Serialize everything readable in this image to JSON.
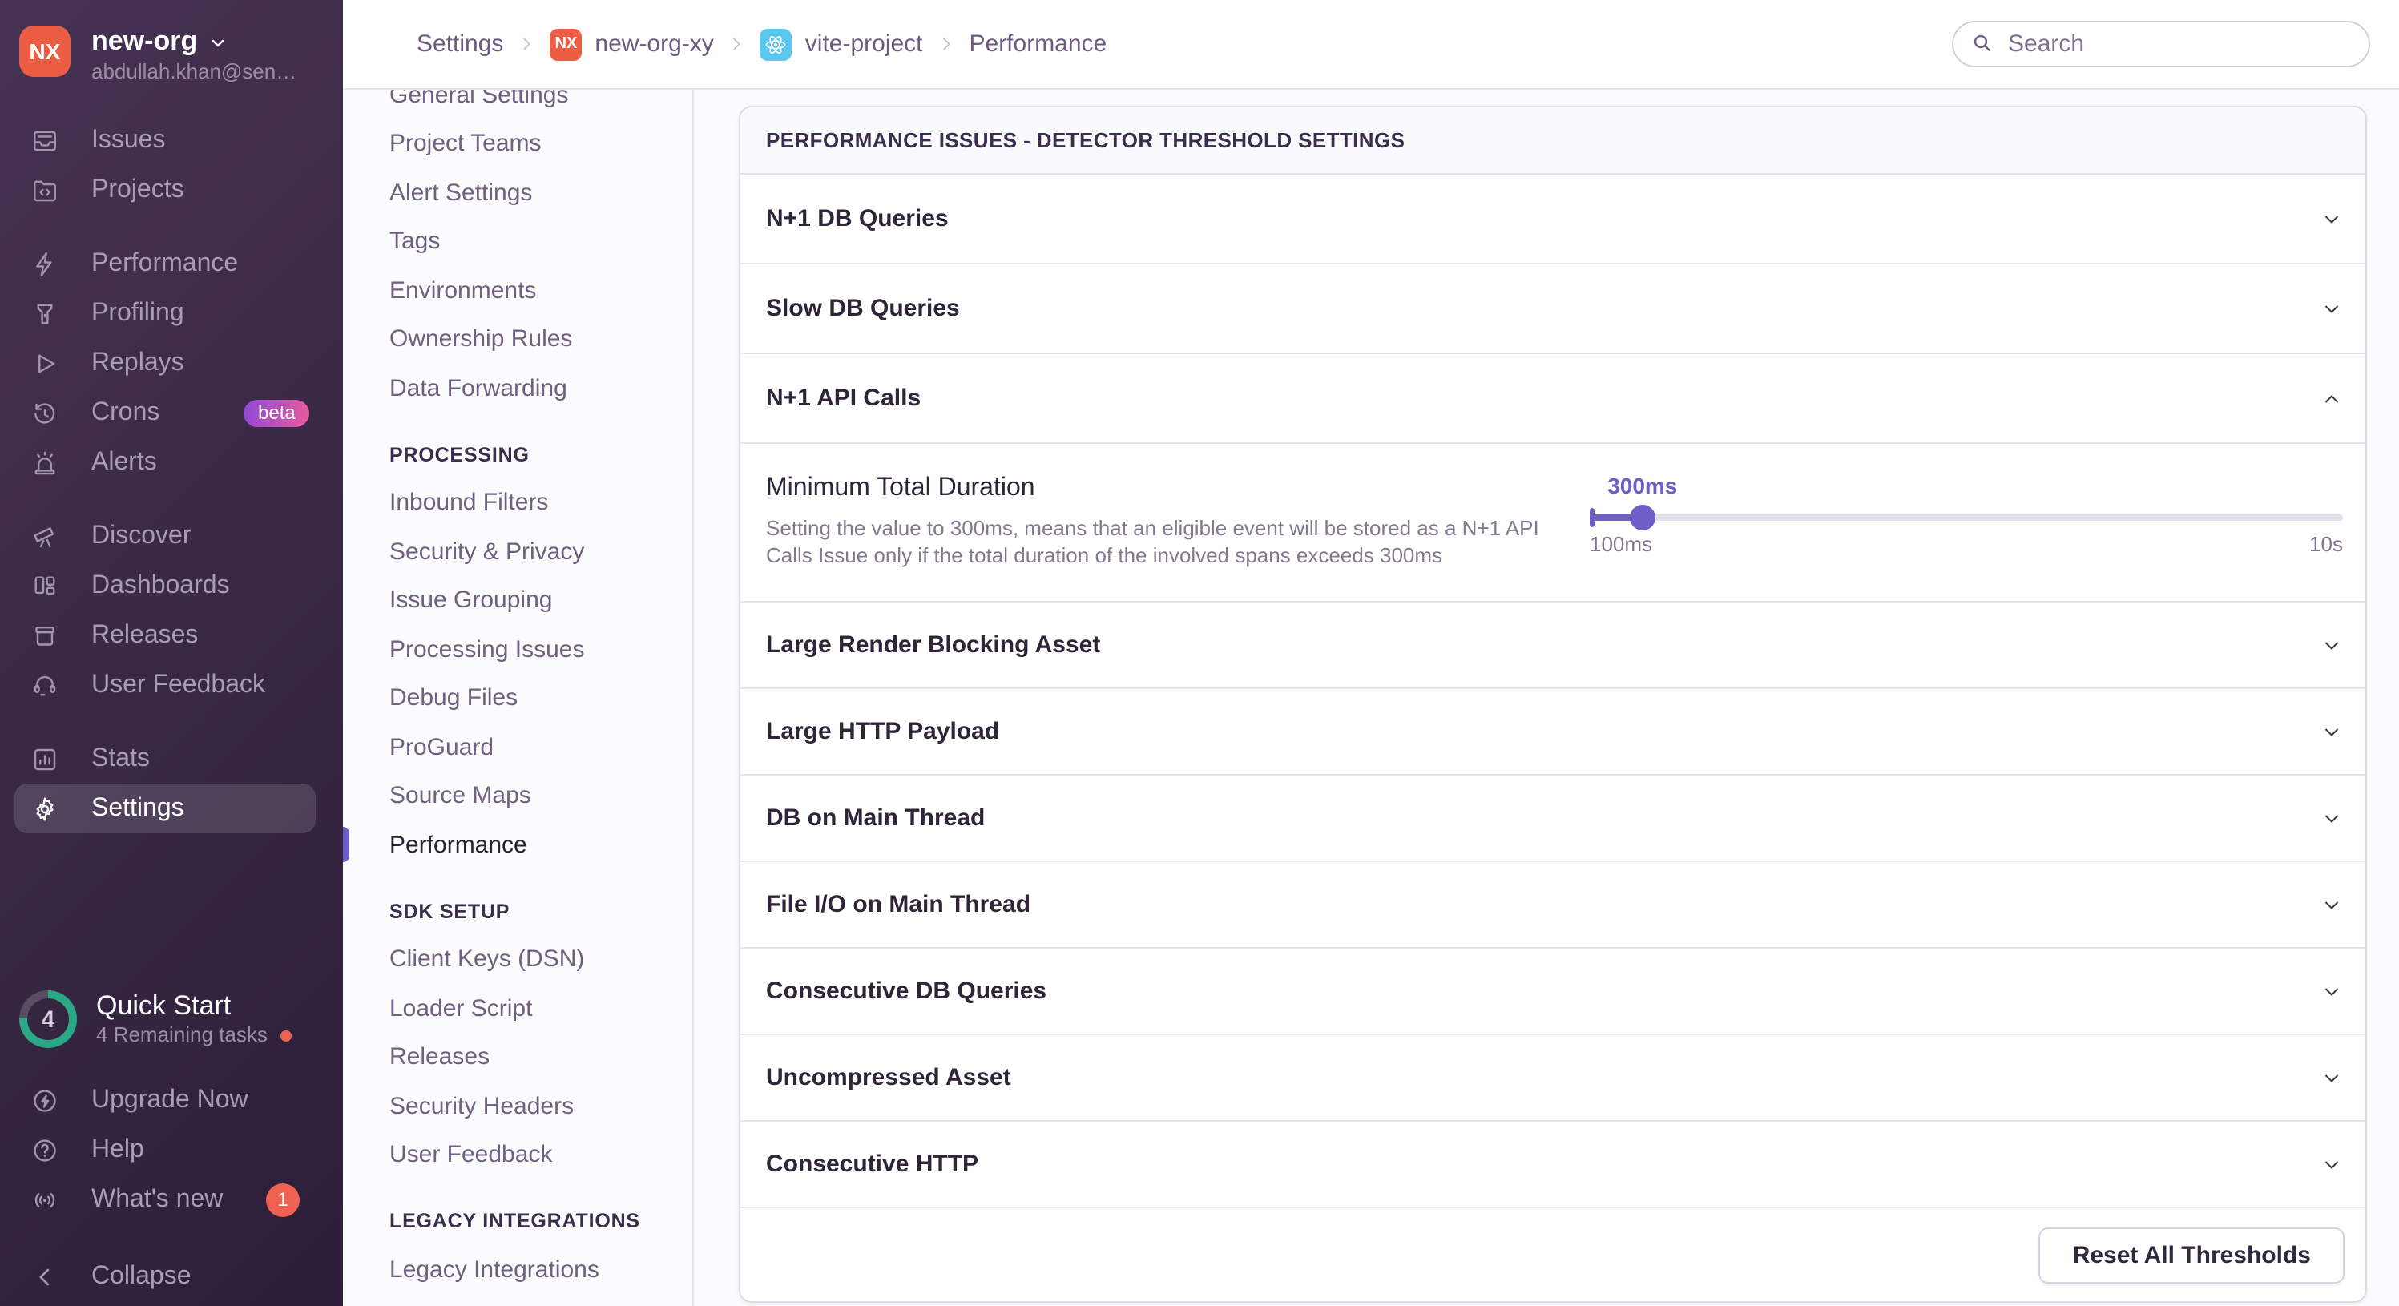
{
  "colors": {
    "accent": "#6C5FC7",
    "sidebar_top": "#463253",
    "sidebar_bottom": "#2B1D37",
    "org_avatar_bg": "#EC5E44",
    "beta_badge_from": "#8E49D8",
    "beta_badge_to": "#EA5A9C",
    "alert_badge": "#EF6150",
    "quickstart_ring": "#2BA885",
    "react_badge_bg": "#5BC7EE"
  },
  "sidebar": {
    "org": {
      "initials": "NX",
      "name": "new-org",
      "email": "abdullah.khan@sen…"
    },
    "items": [
      {
        "label": "Issues",
        "icon": "issues-icon"
      },
      {
        "label": "Projects",
        "icon": "projects-icon"
      },
      {
        "label": "Performance",
        "icon": "performance-icon"
      },
      {
        "label": "Profiling",
        "icon": "profiling-icon"
      },
      {
        "label": "Replays",
        "icon": "replays-icon"
      },
      {
        "label": "Crons",
        "icon": "crons-icon",
        "badge": "beta"
      },
      {
        "label": "Alerts",
        "icon": "alerts-icon"
      },
      {
        "label": "Discover",
        "icon": "discover-icon"
      },
      {
        "label": "Dashboards",
        "icon": "dashboards-icon"
      },
      {
        "label": "Releases",
        "icon": "releases-icon"
      },
      {
        "label": "User Feedback",
        "icon": "user-feedback-icon"
      },
      {
        "label": "Stats",
        "icon": "stats-icon"
      },
      {
        "label": "Settings",
        "icon": "settings-icon",
        "active": true
      }
    ],
    "quickstart": {
      "title": "Quick Start",
      "subtitle": "4 Remaining tasks",
      "count": "4",
      "percent": 76
    },
    "footer_items": [
      {
        "label": "Upgrade Now",
        "icon": "upgrade-icon"
      },
      {
        "label": "Help",
        "icon": "help-icon"
      },
      {
        "label": "What's new",
        "icon": "broadcast-icon",
        "badge": "1"
      }
    ],
    "collapse_label": "Collapse"
  },
  "header": {
    "breadcrumb": {
      "settings": "Settings",
      "org": "new-org-xy",
      "org_initials": "NX",
      "project": "vite-project",
      "page": "Performance"
    },
    "search_placeholder": "Search"
  },
  "settings_nav": {
    "groups": [
      {
        "header": "",
        "items": [
          "General Settings",
          "Project Teams",
          "Alert Settings",
          "Tags",
          "Environments",
          "Ownership Rules",
          "Data Forwarding"
        ]
      },
      {
        "header": "PROCESSING",
        "items": [
          "Inbound Filters",
          "Security & Privacy",
          "Issue Grouping",
          "Processing Issues",
          "Debug Files",
          "ProGuard",
          "Source Maps",
          "Performance"
        ],
        "active_item": "Performance"
      },
      {
        "header": "SDK SETUP",
        "items": [
          "Client Keys (DSN)",
          "Loader Script",
          "Releases",
          "Security Headers",
          "User Feedback"
        ]
      },
      {
        "header": "LEGACY INTEGRATIONS",
        "items": [
          "Legacy Integrations"
        ]
      }
    ]
  },
  "panel": {
    "title": "PERFORMANCE ISSUES - DETECTOR THRESHOLD SETTINGS",
    "rows": [
      {
        "label": "N+1 DB Queries",
        "state": "collapsed"
      },
      {
        "label": "Slow DB Queries",
        "state": "collapsed"
      },
      {
        "label": "N+1 API Calls",
        "state": "expanded"
      },
      {
        "label": "Large Render Blocking Asset",
        "state": "collapsed"
      },
      {
        "label": "Large HTTP Payload",
        "state": "collapsed"
      },
      {
        "label": "DB on Main Thread",
        "state": "collapsed"
      },
      {
        "label": "File I/O on Main Thread",
        "state": "collapsed"
      },
      {
        "label": "Consecutive DB Queries",
        "state": "collapsed"
      },
      {
        "label": "Uncompressed Asset",
        "state": "collapsed"
      },
      {
        "label": "Consecutive HTTP",
        "state": "collapsed"
      }
    ],
    "expanded": {
      "title": "Minimum Total Duration",
      "description": "Setting the value to 300ms, means that an eligible event will be stored as a N+1 API Calls Issue only if the total duration of the involved spans exceeds 300ms",
      "slider": {
        "value": "300ms",
        "min": "100ms",
        "max": "10s",
        "percent": 7
      }
    },
    "footer": {
      "reset_label": "Reset All Thresholds"
    }
  }
}
